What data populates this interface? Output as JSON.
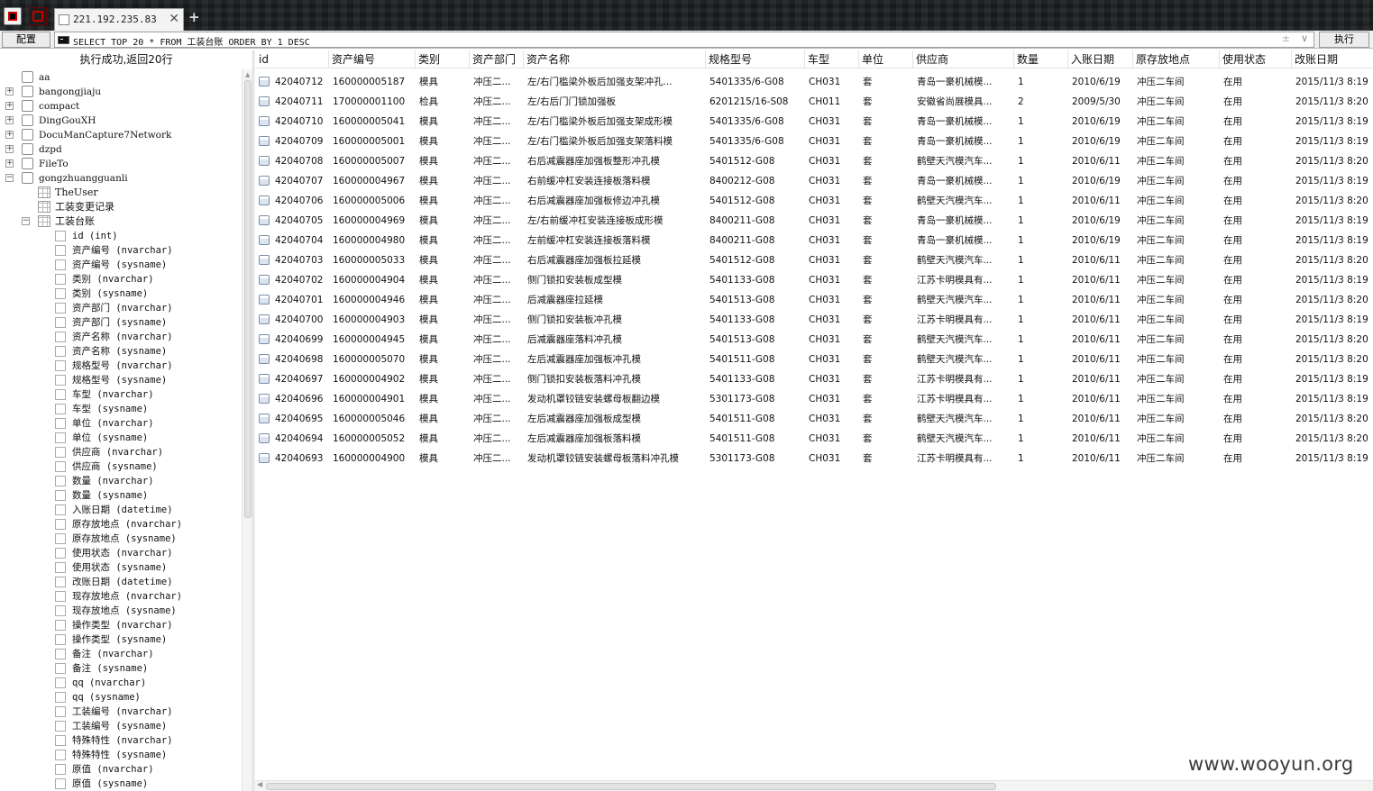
{
  "tab": {
    "title": "221.192.235.83",
    "close": "✕",
    "add": "+"
  },
  "toolbar": {
    "config_label": "配置",
    "sql": "SELECT TOP 20 * FROM 工装台账 ORDER BY 1 DESC",
    "aux_symbol": "±",
    "dropdown_symbol": "∨",
    "execute_label": "执行"
  },
  "status": "执行成功,返回20行",
  "tree": {
    "databases": [
      {
        "name": "aa",
        "expander": ""
      },
      {
        "name": "bangongjiaju",
        "expander": "+"
      },
      {
        "name": "compact",
        "expander": "+"
      },
      {
        "name": "DingGouXH",
        "expander": "+"
      },
      {
        "name": "DocuManCapture7Network",
        "expander": "+"
      },
      {
        "name": "dzpd",
        "expander": "+"
      },
      {
        "name": "FileTo",
        "expander": "+"
      },
      {
        "name": "gongzhuangguanli",
        "expander": "−"
      }
    ],
    "tables": [
      {
        "name": "TheUser",
        "expander": ""
      },
      {
        "name": "工装变更记录",
        "expander": ""
      },
      {
        "name": "工装台账",
        "expander": "−"
      }
    ],
    "columns": [
      "id (int)",
      "资产编号 (nvarchar)",
      "资产编号 (sysname)",
      "类别 (nvarchar)",
      "类别 (sysname)",
      "资产部门 (nvarchar)",
      "资产部门 (sysname)",
      "资产名称 (nvarchar)",
      "资产名称 (sysname)",
      "规格型号 (nvarchar)",
      "规格型号 (sysname)",
      "车型 (nvarchar)",
      "车型 (sysname)",
      "单位 (nvarchar)",
      "单位 (sysname)",
      "供应商 (nvarchar)",
      "供应商 (sysname)",
      "数量 (nvarchar)",
      "数量 (sysname)",
      "入账日期 (datetime)",
      "原存放地点 (nvarchar)",
      "原存放地点 (sysname)",
      "使用状态 (nvarchar)",
      "使用状态 (sysname)",
      "改账日期 (datetime)",
      "现存放地点 (nvarchar)",
      "现存放地点 (sysname)",
      "操作类型 (nvarchar)",
      "操作类型 (sysname)",
      "备注 (nvarchar)",
      "备注 (sysname)",
      "qq (nvarchar)",
      "qq (sysname)",
      "工装编号 (nvarchar)",
      "工装编号 (sysname)",
      "特殊特性 (nvarchar)",
      "特殊特性 (sysname)",
      "原值 (nvarchar)",
      "原值 (sysname)"
    ]
  },
  "grid": {
    "columns": [
      "id",
      "资产编号",
      "类别",
      "资产部门",
      "资产名称",
      "规格型号",
      "车型",
      "单位",
      "供应商",
      "数量",
      "入账日期",
      "原存放地点",
      "使用状态",
      "改账日期"
    ],
    "rows": [
      [
        "42040712",
        "160000005187",
        "模具",
        "冲压二...",
        "左/右门槛梁外板后加强支架冲孔...",
        "5401335/6-G08",
        "CH031",
        "套",
        "青岛一豪机械模...",
        "1",
        "2010/6/19",
        "冲压二车间",
        "在用",
        "2015/11/3 8:19"
      ],
      [
        "42040711",
        "170000001100",
        "检具",
        "冲压二...",
        "左/右后门门锁加强板",
        "6201215/16-S08",
        "CH011",
        "套",
        "安徽省尚展模具...",
        "2",
        "2009/5/30",
        "冲压二车间",
        "在用",
        "2015/11/3 8:20"
      ],
      [
        "42040710",
        "160000005041",
        "模具",
        "冲压二...",
        "左/右门槛梁外板后加强支架成形模",
        "5401335/6-G08",
        "CH031",
        "套",
        "青岛一豪机械模...",
        "1",
        "2010/6/19",
        "冲压二车间",
        "在用",
        "2015/11/3 8:19"
      ],
      [
        "42040709",
        "160000005001",
        "模具",
        "冲压二...",
        "左/右门槛梁外板后加强支架落料模",
        "5401335/6-G08",
        "CH031",
        "套",
        "青岛一豪机械模...",
        "1",
        "2010/6/19",
        "冲压二车间",
        "在用",
        "2015/11/3 8:19"
      ],
      [
        "42040708",
        "160000005007",
        "模具",
        "冲压二...",
        "右后减震器座加强板整形冲孔模",
        "5401512-G08",
        "CH031",
        "套",
        "鹤壁天汽模汽车...",
        "1",
        "2010/6/11",
        "冲压二车间",
        "在用",
        "2015/11/3 8:20"
      ],
      [
        "42040707",
        "160000004967",
        "模具",
        "冲压二...",
        "右前缓冲杠安装连接板落料模",
        "8400212-G08",
        "CH031",
        "套",
        "青岛一豪机械模...",
        "1",
        "2010/6/19",
        "冲压二车间",
        "在用",
        "2015/11/3 8:19"
      ],
      [
        "42040706",
        "160000005006",
        "模具",
        "冲压二...",
        "右后减震器座加强板修边冲孔模",
        "5401512-G08",
        "CH031",
        "套",
        "鹤壁天汽模汽车...",
        "1",
        "2010/6/11",
        "冲压二车间",
        "在用",
        "2015/11/3 8:20"
      ],
      [
        "42040705",
        "160000004969",
        "模具",
        "冲压二...",
        "左/右前缓冲杠安装连接板成形模",
        "8400211-G08",
        "CH031",
        "套",
        "青岛一豪机械模...",
        "1",
        "2010/6/19",
        "冲压二车间",
        "在用",
        "2015/11/3 8:19"
      ],
      [
        "42040704",
        "160000004980",
        "模具",
        "冲压二...",
        "左前缓冲杠安装连接板落料模",
        "8400211-G08",
        "CH031",
        "套",
        "青岛一豪机械模...",
        "1",
        "2010/6/19",
        "冲压二车间",
        "在用",
        "2015/11/3 8:19"
      ],
      [
        "42040703",
        "160000005033",
        "模具",
        "冲压二...",
        "右后减震器座加强板拉延模",
        "5401512-G08",
        "CH031",
        "套",
        "鹤壁天汽模汽车...",
        "1",
        "2010/6/11",
        "冲压二车间",
        "在用",
        "2015/11/3 8:20"
      ],
      [
        "42040702",
        "160000004904",
        "模具",
        "冲压二...",
        "侧门锁扣安装板成型模",
        "5401133-G08",
        "CH031",
        "套",
        "江苏卡明模具有...",
        "1",
        "2010/6/11",
        "冲压二车间",
        "在用",
        "2015/11/3 8:19"
      ],
      [
        "42040701",
        "160000004946",
        "模具",
        "冲压二...",
        "后减震器座拉延模",
        "5401513-G08",
        "CH031",
        "套",
        "鹤壁天汽模汽车...",
        "1",
        "2010/6/11",
        "冲压二车间",
        "在用",
        "2015/11/3 8:20"
      ],
      [
        "42040700",
        "160000004903",
        "模具",
        "冲压二...",
        "侧门锁扣安装板冲孔模",
        "5401133-G08",
        "CH031",
        "套",
        "江苏卡明模具有...",
        "1",
        "2010/6/11",
        "冲压二车间",
        "在用",
        "2015/11/3 8:19"
      ],
      [
        "42040699",
        "160000004945",
        "模具",
        "冲压二...",
        "后减震器座落料冲孔模",
        "5401513-G08",
        "CH031",
        "套",
        "鹤壁天汽模汽车...",
        "1",
        "2010/6/11",
        "冲压二车间",
        "在用",
        "2015/11/3 8:20"
      ],
      [
        "42040698",
        "160000005070",
        "模具",
        "冲压二...",
        "左后减震器座加强板冲孔模",
        "5401511-G08",
        "CH031",
        "套",
        "鹤壁天汽模汽车...",
        "1",
        "2010/6/11",
        "冲压二车间",
        "在用",
        "2015/11/3 8:20"
      ],
      [
        "42040697",
        "160000004902",
        "模具",
        "冲压二...",
        "侧门锁扣安装板落料冲孔模",
        "5401133-G08",
        "CH031",
        "套",
        "江苏卡明模具有...",
        "1",
        "2010/6/11",
        "冲压二车间",
        "在用",
        "2015/11/3 8:19"
      ],
      [
        "42040696",
        "160000004901",
        "模具",
        "冲压二...",
        "发动机罩铰链安装螺母板翻边模",
        "5301173-G08",
        "CH031",
        "套",
        "江苏卡明模具有...",
        "1",
        "2010/6/11",
        "冲压二车间",
        "在用",
        "2015/11/3 8:19"
      ],
      [
        "42040695",
        "160000005046",
        "模具",
        "冲压二...",
        "左后减震器座加强板成型模",
        "5401511-G08",
        "CH031",
        "套",
        "鹤壁天汽模汽车...",
        "1",
        "2010/6/11",
        "冲压二车间",
        "在用",
        "2015/11/3 8:20"
      ],
      [
        "42040694",
        "160000005052",
        "模具",
        "冲压二...",
        "左后减震器座加强板落料模",
        "5401511-G08",
        "CH031",
        "套",
        "鹤壁天汽模汽车...",
        "1",
        "2010/6/11",
        "冲压二车间",
        "在用",
        "2015/11/3 8:20"
      ],
      [
        "42040693",
        "160000004900",
        "模具",
        "冲压二...",
        "发动机罩铰链安装螺母板落料冲孔模",
        "5301173-G08",
        "CH031",
        "套",
        "江苏卡明模具有...",
        "1",
        "2010/6/11",
        "冲压二车间",
        "在用",
        "2015/11/3 8:19"
      ]
    ]
  },
  "watermark": "www.wooyun.org"
}
